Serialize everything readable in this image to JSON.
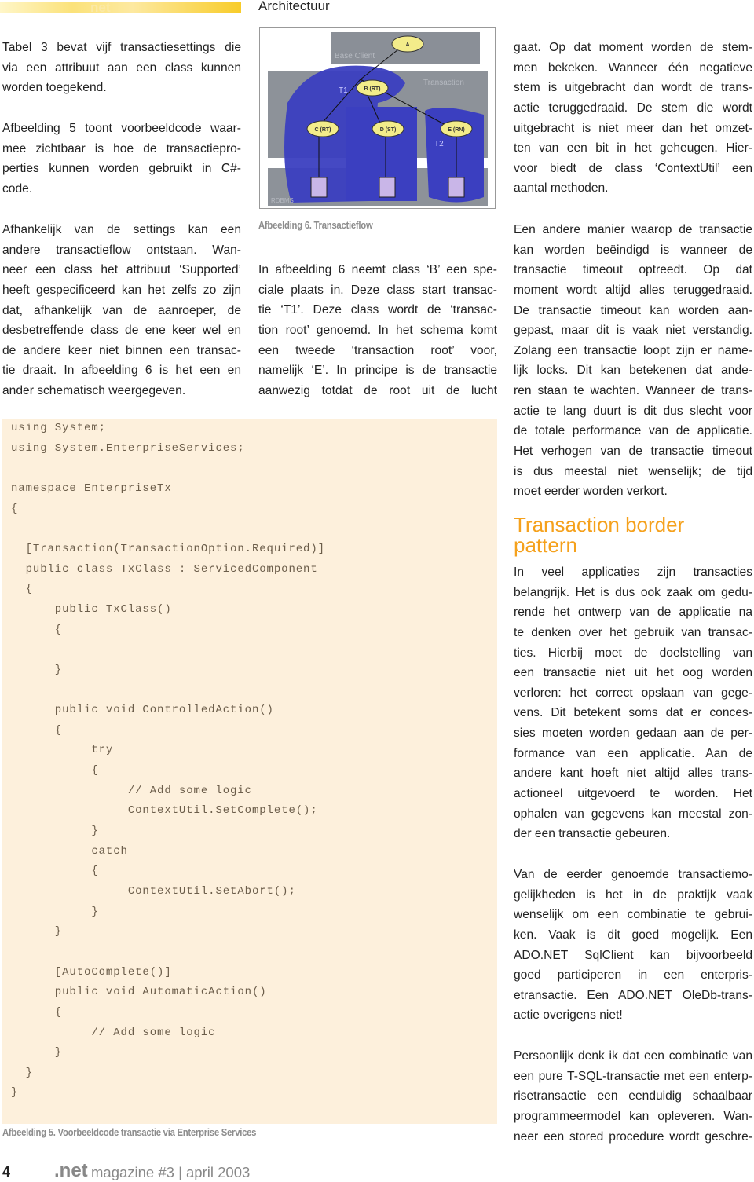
{
  "header": {
    "logo_text": "net",
    "section": "Architectuur"
  },
  "columns": [
    {
      "paragraphs": [
        {
          "lines": [
            "Tabel 3 bevat vijf transactiesettings die",
            "via een attribuut aan een class kunnen",
            "worden toegekend."
          ]
        },
        {
          "lines": [
            "Afbeelding 5 toont voorbeeldcode waar-",
            "mee zichtbaar is hoe de transactiepro-",
            "perties kunnen worden gebruikt in C#-",
            "code."
          ]
        },
        {
          "lines": [
            "Afhankelijk van de settings kan een",
            "andere transactieflow ontstaan. Wan-",
            "neer een class het attribuut ‘Supported’",
            "heeft gespecificeerd kan het zelfs zo zijn",
            "dat, afhankelijk van de aanroeper, de",
            "desbetreffende class de ene keer wel en",
            "de andere keer niet binnen een transac-",
            "tie draait. In afbeelding 6 is het een en",
            "ander schematisch weergegeven."
          ]
        }
      ]
    },
    {
      "paragraphs": [
        {
          "lines": [
            "In afbeelding 6 neemt class ‘B’ een spe-",
            "ciale plaats in. Deze class start transac-",
            "tie ‘T1’. Deze class wordt de ‘transac-",
            "tion root’ genoemd. In het schema komt",
            "een tweede ‘transaction root’ voor,",
            "namelijk ‘E’. In principe is de transactie",
            "aanwezig totdat de root uit de lucht"
          ],
          "continues": true
        }
      ]
    },
    {
      "paragraphs": [
        {
          "lines": [
            "gaat. Op dat moment worden de stem-",
            "men bekeken. Wanneer één negatieve",
            "stem is uitgebracht dan wordt de trans-",
            "actie teruggedraaid. De stem die wordt",
            "uitgebracht is niet meer dan het omzet-",
            "ten van een bit in het geheugen. Hier-",
            "voor biedt de class ‘ContextUtil’ een",
            "aantal methoden."
          ]
        },
        {
          "lines": [
            "Een andere manier waarop de transactie",
            "kan worden beëindigd is wanneer de",
            "transactie timeout optreedt. Op dat",
            "moment wordt altijd alles teruggedraaid.",
            "De transactie timeout kan worden aan-",
            "gepast, maar dit is vaak niet verstandig.",
            "Zolang een transactie loopt zijn er name-",
            "lijk locks. Dit kan betekenen dat ande-",
            "ren staan te wachten. Wanneer de trans-",
            "actie te lang duurt is dit dus slecht voor",
            "de totale performance van de applicatie.",
            "Het verhogen van de transactie timeout",
            "is dus meestal niet wenselijk; de tijd",
            "moet eerder worden verkort."
          ]
        },
        {
          "lines": [
            "In veel applicaties zijn transacties",
            "belangrijk. Het is dus ook zaak om gedu-",
            "rende het ontwerp van de applicatie na",
            "te denken over het gebruik van transac-",
            "ties. Hierbij moet de doelstelling van",
            "een transactie niet uit het oog worden",
            "verloren: het correct opslaan van gege-",
            "vens. Dit betekent soms dat er conces-",
            "sies moeten worden gedaan aan de per-",
            "formance van een applicatie. Aan de",
            "andere kant hoeft niet altijd alles trans-",
            "actioneel uitgevoerd te worden. Het",
            "ophalen van gegevens kan meestal zon-",
            "der een transactie gebeuren."
          ]
        },
        {
          "lines": [
            "Van de eerder genoemde transactiemo-",
            "gelijkheden is het in de praktijk vaak",
            "wenselijk om een combinatie te gebrui-",
            "ken. Vaak is dit goed mogelijk. Een",
            "ADO.NET SqlClient kan bijvoorbeeld",
            "goed participeren in een enterpris-",
            "etransactie. Een ADO.NET OleDb-trans-",
            "actie overigens niet!"
          ]
        },
        {
          "lines": [
            "Persoonlijk denk ik dat een combinatie van",
            "een pure T-SQL-transactie met een enterp-",
            "risetransactie een eenduidig schaalbaar",
            "programmeermodel kan opleveren. Wan-",
            "neer een stored procedure wordt geschre-"
          ],
          "continues": true
        }
      ]
    }
  ],
  "heading": {
    "line1": "Transaction border",
    "line2": "pattern"
  },
  "figure6": {
    "caption": "Afbeelding 6. Transactieflow",
    "labels": {
      "base_client": "Base Client",
      "transaction": "Transaction",
      "rdbms": "RDBMS",
      "t1": "T1",
      "t2": "T2"
    },
    "nodes": [
      "A",
      "B (RT)",
      "C (RT)",
      "D (ST)",
      "E (RN)"
    ]
  },
  "code": {
    "lines": [
      "using System;",
      "using System.EnterpriseServices;",
      "",
      "namespace EnterpriseTx",
      "{",
      "",
      "  [Transaction(TransactionOption.Required)]",
      "  public class TxClass : ServicedComponent",
      "  {",
      "      public TxClass()",
      "      {",
      "",
      "      }",
      "",
      "      public void ControlledAction()",
      "      {",
      "           try",
      "           {",
      "                // Add some logic",
      "                ContextUtil.SetComplete();",
      "           }",
      "           catch",
      "           {",
      "                ContextUtil.SetAbort();",
      "           }",
      "      }",
      "",
      "      [AutoComplete()]",
      "      public void AutomaticAction()",
      "      {",
      "           // Add some logic",
      "      }",
      "  }",
      "}"
    ],
    "caption": "Afbeelding 5. Voorbeeldcode transactie via Enterprise Services"
  },
  "footer": {
    "page": "4",
    "brand": ".net",
    "issue": "magazine #3 | april 2003"
  },
  "colors": {
    "accent": "#f5a11c",
    "code_bg": "#fdf0dc",
    "diagram_blue": "#3b3fc0"
  }
}
